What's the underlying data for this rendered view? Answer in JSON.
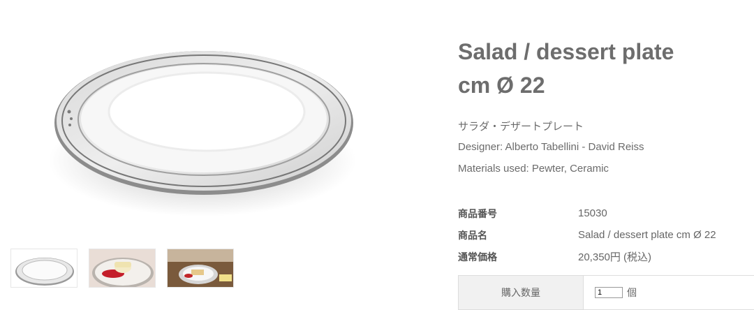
{
  "product": {
    "title_line1": "Salad / dessert plate",
    "title_line2": "cm Ø 22",
    "japanese_name": "サラダ・デザートプレート",
    "designer": "Designer: Alberto Tabellini - David Reiss",
    "materials": "Materials used: Pewter, Ceramic"
  },
  "specs": [
    {
      "key": "商品番号",
      "value": "15030"
    },
    {
      "key": "商品名",
      "value": "Salad / dessert plate cm Ø 22"
    },
    {
      "key": "通常価格",
      "value": "20,350円 (税込)"
    }
  ],
  "quantity": {
    "label": "購入数量",
    "value": "1",
    "unit": "個"
  },
  "gallery": {
    "thumbnails": [
      "plate-image",
      "dessert-image",
      "table-setting-image"
    ]
  },
  "colors": {
    "text": "#6d6d6d",
    "pewter": "#a9a9a9",
    "table_header_bg": "#f1f1f1",
    "border": "#dddddd"
  }
}
